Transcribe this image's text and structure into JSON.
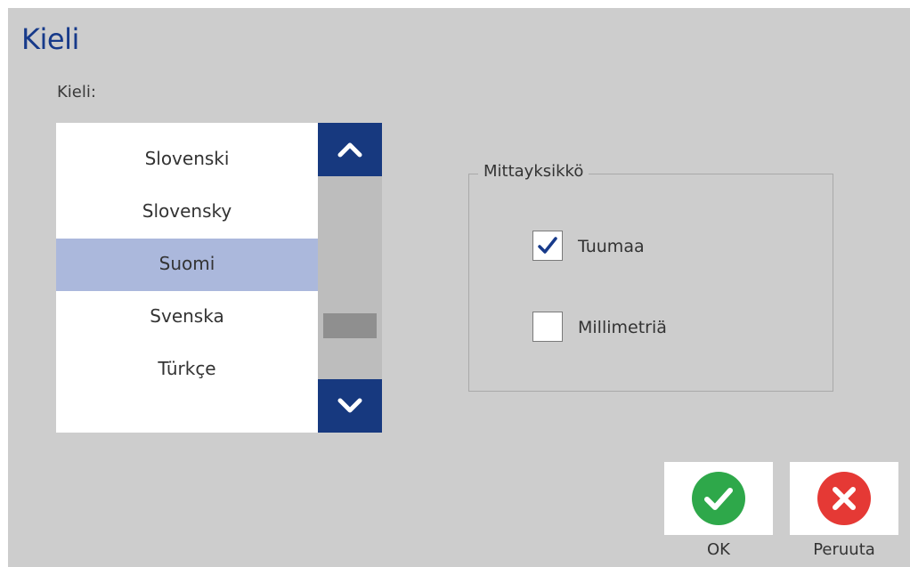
{
  "dialog": {
    "title": "Kieli",
    "language_label": "Kieli:"
  },
  "language_list": {
    "items": [
      "Slovenski",
      "Slovensky",
      "Suomi",
      "Svenska",
      "Türkçe"
    ],
    "selected": "Suomi"
  },
  "scrollbar": {
    "up_icon": "chevron-up-icon",
    "down_icon": "chevron-down-icon"
  },
  "units": {
    "legend": "Mittayksikkö",
    "options": [
      {
        "label": "Tuumaa",
        "checked": true
      },
      {
        "label": "Millimetriä",
        "checked": false
      }
    ]
  },
  "buttons": {
    "ok_label": "OK",
    "cancel_label": "Peruuta"
  },
  "colors": {
    "title": "#173a8a",
    "selection": "#abb8dc",
    "scroll_button": "#17397f",
    "ok": "#2ea84a",
    "cancel": "#e53935"
  }
}
